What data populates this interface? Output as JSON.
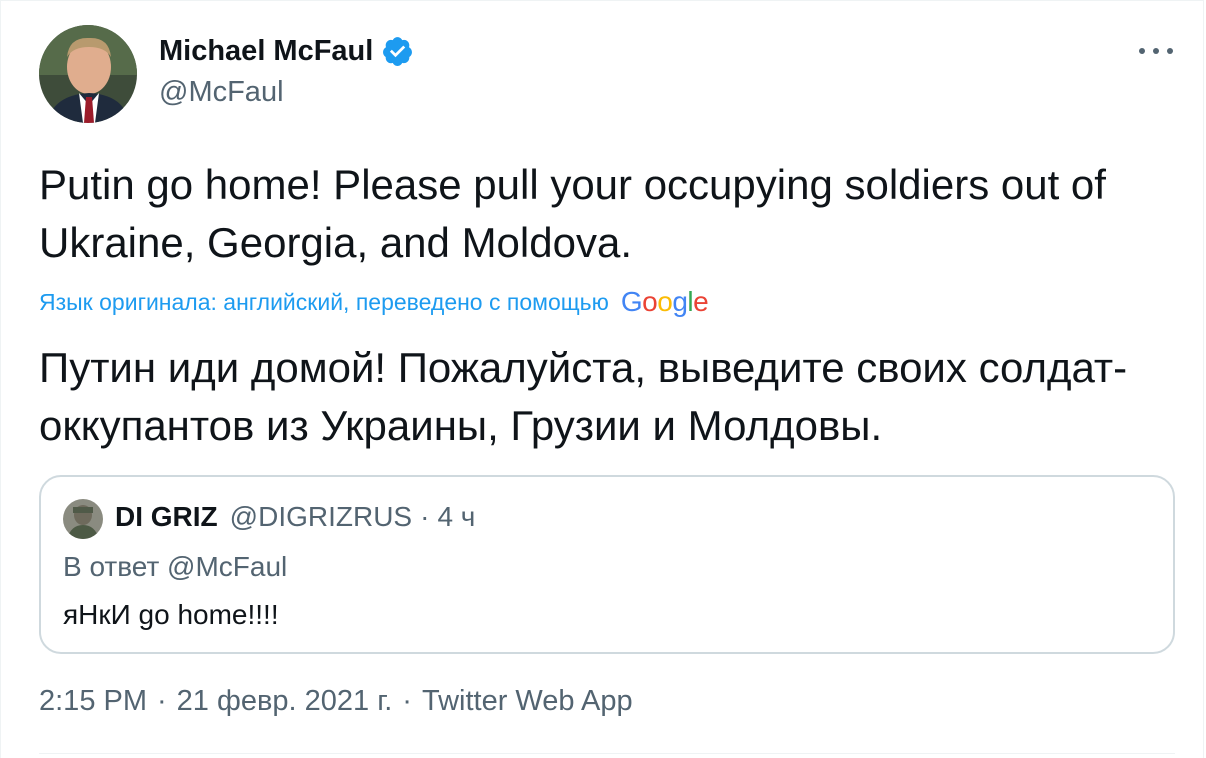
{
  "tweet": {
    "author_name": "Michael McFaul",
    "author_handle": "@McFaul",
    "text": "Putin go home! Please pull your occupying soldiers out of Ukraine, Georgia, and Moldova.",
    "translation_label": "Язык оригинала: английский, переведено с помощью",
    "translator_brand": "Google",
    "translated_text": "Путин иди домой! Пожалуйста, выведите своих солдат-оккупантов из Украины, Грузии и Молдовы.",
    "time": "2:15 PM",
    "date": "21 февр. 2021 г.",
    "source": "Twitter Web App",
    "separator": "·"
  },
  "quote": {
    "author_name": "DI GRIZ",
    "author_handle": "@DIGRIZRUS",
    "separator": "·",
    "time": "4 ч",
    "reply_to": "В ответ @McFaul",
    "text": "яНкИ go home!!!!"
  },
  "icons": {
    "verified": "verified-badge-icon",
    "more": "more-options-icon"
  },
  "colors": {
    "accent": "#1d9bf0",
    "secondary_text": "#536471",
    "border": "#cfd9de"
  }
}
